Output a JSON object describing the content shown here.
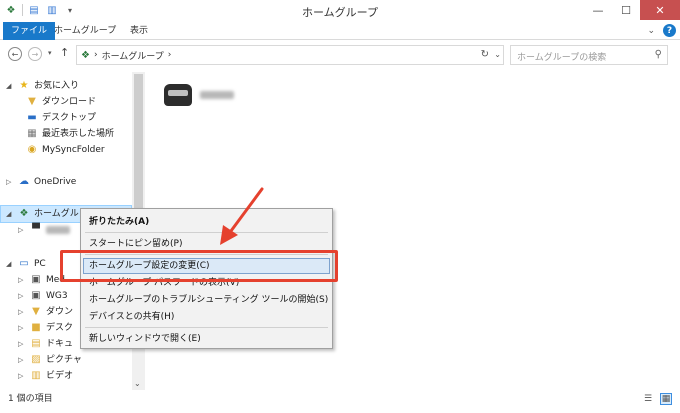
{
  "window": {
    "title": "ホームグループ"
  },
  "ribbon": {
    "tabs": [
      "ファイル",
      "ホームグループ",
      "表示"
    ]
  },
  "address": {
    "path": "ホームグループ",
    "separator": "›"
  },
  "search": {
    "placeholder": "ホームグループの検索"
  },
  "navpane": {
    "favorites": "お気に入り",
    "downloads": "ダウンロード",
    "desktop": "デスクトップ",
    "recent": "最近表示した場所",
    "mysync": "MySyncFolder",
    "onedrive": "OneDrive",
    "homegroup": "ホームグル",
    "pc": "PC",
    "pc_children": [
      "Med",
      "WG3",
      "ダウン",
      "デスク",
      "ドキュ",
      "ピクチャ",
      "ビデオ"
    ]
  },
  "context_menu": {
    "items": [
      "折りたたみ(A)",
      "スタートにピン留め(P)",
      "ホームグループ設定の変更(C)",
      "ホームグループ パスワードの表示(V)",
      "ホームグループのトラブルシューティング ツールの開始(S)",
      "デバイスとの共有(H)",
      "新しいウィンドウで開く(E)"
    ],
    "highlighted_index": 2
  },
  "status": {
    "text": "1 個の項目"
  },
  "colors": {
    "accent": "#1979ca",
    "annotation": "#e5412e",
    "highlight": "#cce8ff"
  }
}
